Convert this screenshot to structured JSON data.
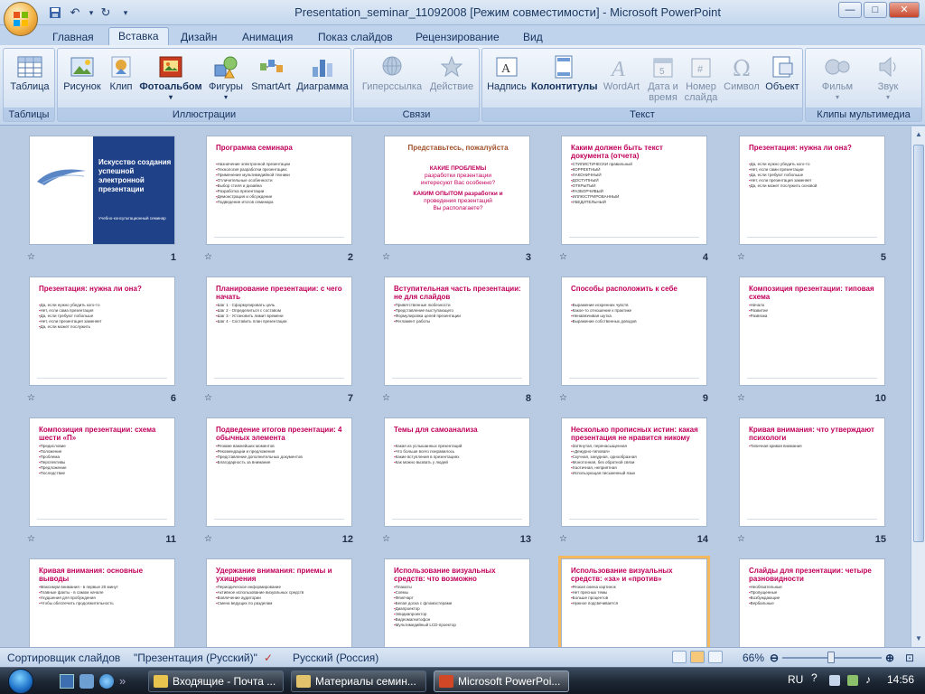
{
  "window": {
    "title": "Presentation_seminar_11092008 [Режим совместимости] - Microsoft PowerPoint",
    "controls": {
      "minimize": "—",
      "maximize": "□",
      "close": "✕"
    }
  },
  "qat": {
    "save": "save-icon",
    "undo": "↶",
    "redo": "↻",
    "more": "▾"
  },
  "tabs": [
    {
      "label": "Главная"
    },
    {
      "label": "Вставка",
      "active": true
    },
    {
      "label": "Дизайн"
    },
    {
      "label": "Анимация"
    },
    {
      "label": "Показ слайдов"
    },
    {
      "label": "Рецензирование"
    },
    {
      "label": "Вид"
    }
  ],
  "ribbon": {
    "groups": {
      "tables": "Таблицы",
      "illustrations": "Иллюстрации",
      "links": "Связи",
      "text": "Текст",
      "media": "Клипы мультимедиа"
    },
    "buttons": {
      "table": "Таблица",
      "picture": "Рисунок",
      "clip": "Клип",
      "photoalbum": "Фотоальбом",
      "shapes": "Фигуры",
      "smartart": "SmartArt",
      "chart": "Диаграмма",
      "hyperlink": "Гиперссылка",
      "action": "Действие",
      "textbox": "Надпись",
      "headerfooter": "Колонтитулы",
      "wordart": "WordArt",
      "datetime_1": "Дата и",
      "datetime_2": "время",
      "slidenum_1": "Номер",
      "slidenum_2": "слайда",
      "symbol": "Символ",
      "object": "Объект",
      "movie": "Фильм",
      "sound": "Звук"
    }
  },
  "slides": [
    {
      "num": "1",
      "kind": "title",
      "title": "Искусство создания успешной электронной презентации",
      "subtitle": "Учебно-консультационный семинар"
    },
    {
      "num": "2",
      "title": "Программа семинара",
      "lines": [
        "Назначение электронной презентации",
        "Технология разработки презентации:",
        "Применение мультимедийной техники",
        "Отличительные особенности",
        "Выбор стиля и дизайна",
        "Разработка презентации",
        "Демонстрация и обсуждение",
        "Подведение итогов семинара"
      ]
    },
    {
      "num": "3",
      "kind": "center",
      "title": "Представьтесь, пожалуйста",
      "lines": [
        "КАКИЕ ПРОБЛЕМЫ",
        "разработки презентации",
        "интересуют Вас особенно?",
        "КАКИМ ОПЫТОМ разработки и",
        "проведения презентаций",
        "Вы располагаете?"
      ]
    },
    {
      "num": "4",
      "title": "Каким должен быть текст документа (отчета)",
      "lines": [
        "СТИЛИСТИЧЕСКИ правильный",
        "КОРРЕКТНЫЙ",
        "ЛАКОНИЧНЫЙ",
        "ДОСТУПНЫЙ",
        "ОТКРЫТЫЙ",
        "РАЗБОРЧИВЫЙ",
        "ИЛЛЮСТРИРОВАННЫЙ",
        "УБЕДИТЕЛЬНЫЙ"
      ]
    },
    {
      "num": "5",
      "title": "Презентация: нужна ли она?",
      "lines": [
        "Да, если нужно убедить кого-то",
        "Нет, если сами презентации",
        "Да, если требуют побольше",
        "Нет, если презентация заменяет",
        "Да, если может послужить основой"
      ]
    },
    {
      "num": "6",
      "title": "Презентация: нужна ли она?",
      "lines": [
        "Да, если нужно убедить кого-то",
        "Нет, если сама презентация",
        "Да, если требуют побольше",
        "Нет, если презентация заменяет",
        "Да, если может послужить"
      ]
    },
    {
      "num": "7",
      "title": "Планирование презентации: с чего начать",
      "lines": [
        "Шаг 1 - Сформулировать цель",
        "Шаг 2 - Определиться с составом",
        "Шаг 3 - Установить лимит времени",
        "Шаг 4 - Составить план презентации"
      ]
    },
    {
      "num": "8",
      "title": "Вступительная часть презентации: не для слайдов",
      "lines": [
        "Приветственные любезности",
        "Представление выступающего",
        "Формулировка целей презентации",
        "Регламент работы"
      ]
    },
    {
      "num": "9",
      "title": "Способы расположить к себе",
      "lines": [
        "Выражение искренних чувств",
        "Какое-то отношение к практике",
        "Ненавязчивая шутка",
        "Выражение собственных доводов"
      ]
    },
    {
      "num": "10",
      "title": "Композиция презентации: типовая схема",
      "lines": [
        "Начало",
        "Развитие",
        "Развязка"
      ]
    },
    {
      "num": "11",
      "title": "Композиция презентации: схема шести «П»",
      "lines": [
        "Предисловие",
        "Положение",
        "Проблема",
        "Перспективы",
        "Предложение",
        "Последствие"
      ]
    },
    {
      "num": "12",
      "title": "Подведение итогов презентации: 4 обычных элемента",
      "lines": [
        "Резюме важнейших моментов",
        "Рекомендации и предложения",
        "Представление дополнительных документов",
        "Благодарность за внимание"
      ]
    },
    {
      "num": "13",
      "title": "Темы для самоанализа",
      "lines": [
        "Какая из услышанных презентаций",
        "Что больше всего понравилось",
        "Какие вступления в презентациях",
        "Как можно вызвать у людей"
      ]
    },
    {
      "num": "14",
      "title": "Несколько прописных истин: какая презентация не нравится никому",
      "lines": [
        "Затянутая, перенасыщенная",
        "«Дежурно-типовая»",
        "Скучная, занудная, однообразная",
        "Монотонная, без обратной связи",
        "Хаотичная, неприятная",
        "Использующая письменный язык"
      ]
    },
    {
      "num": "15",
      "title": "Кривая внимания: что утверждают психологи",
      "lines": [
        "Типичная кривая внимания"
      ]
    },
    {
      "num": "16",
      "title": "Кривая внимания: основные выводы",
      "lines": [
        "Максимум внимания - в первые 20 минут",
        "Главные факты - в самом начале",
        "Ухудшения для пробуждения",
        "Чтобы обеспечить продолжительность"
      ]
    },
    {
      "num": "17",
      "title": "Удержание внимания: приемы и ухищрения",
      "lines": [
        "Периодическое информирование",
        "Активное использование визуальных средств",
        "Вовлечение аудитории",
        "Смена ведущих по разделам"
      ]
    },
    {
      "num": "18",
      "title": "Использование визуальных средств: что возможно",
      "lines": [
        "Плакаты",
        "Схемы",
        "Флипчарт",
        "Белая доска с фломастерами",
        "Диапроектор",
        "Эпидиапроектор",
        "Видеомагнитофон",
        "Мультимедийный LCD-проектор"
      ]
    },
    {
      "num": "19",
      "title": "Использование визуальных средств: «за» и «против»",
      "lines": [
        "Резкая смена картинок",
        "Нет пресных темы",
        "Больше процентов",
        "Нужное подсвечивается"
      ]
    },
    {
      "num": "20",
      "title": "Слайды для презентации: четыре разновидности",
      "lines": [
        "Необязательные",
        "Пропущенные",
        "Возбуждающие",
        "Вербальные"
      ]
    }
  ],
  "status": {
    "view_name": "Сортировщик слайдов",
    "theme": "\"Презентация (Русский)\"",
    "language": "Русский (Россия)",
    "zoom": "66%",
    "zoom_level": 0.66
  },
  "taskbar": {
    "tasks": [
      {
        "label": "Входящие - Почта ..."
      },
      {
        "label": "Материалы семин..."
      },
      {
        "label": "Microsoft PowerPoi...",
        "active": true
      }
    ],
    "lang": "RU",
    "time": "14:56"
  }
}
